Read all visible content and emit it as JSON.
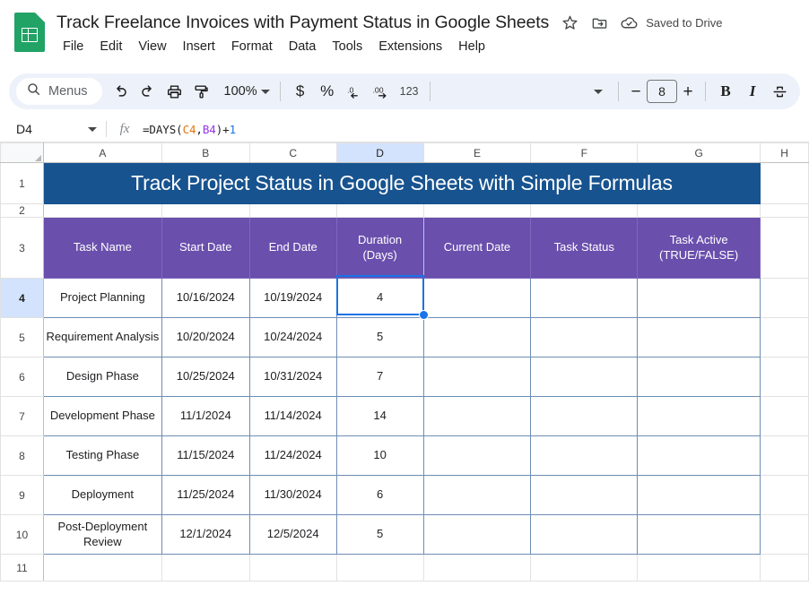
{
  "app": {
    "logo_icon": "google-sheets-logo",
    "doc_title": "Track Freelance Invoices with Payment Status in Google Sheets",
    "star_icon": "star-outline-icon",
    "move_icon": "move-to-folder-icon",
    "cloud_icon": "cloud-saved-icon",
    "save_status": "Saved to Drive"
  },
  "menubar": {
    "items": [
      {
        "label": "File"
      },
      {
        "label": "Edit"
      },
      {
        "label": "View"
      },
      {
        "label": "Insert"
      },
      {
        "label": "Format"
      },
      {
        "label": "Data"
      },
      {
        "label": "Tools"
      },
      {
        "label": "Extensions"
      },
      {
        "label": "Help"
      }
    ]
  },
  "toolbar": {
    "search_icon": "search-icon",
    "search_label": "Menus",
    "undo_icon": "undo-icon",
    "redo_icon": "redo-icon",
    "print_icon": "print-icon",
    "paint_icon": "paint-format-icon",
    "zoom_level": "100%",
    "zoom_caret_icon": "chevron-down-icon",
    "currency_label": "$",
    "percent_label": "%",
    "decimal_decrease_label": ".0",
    "decimal_increase_label": ".00",
    "more_formats_label": "123",
    "font_caret_icon": "chevron-down-icon",
    "decrease_font_label": "−",
    "font_size": "8",
    "increase_font_label": "+",
    "bold_label": "B",
    "italic_label": "I",
    "strikethrough_icon": "strikethrough-icon"
  },
  "formula_bar": {
    "name_box": "D4",
    "name_caret_icon": "chevron-down-icon",
    "fx_label": "fx",
    "formula_parts": [
      {
        "text": "=DAYS(",
        "kind": "plain"
      },
      {
        "text": "C4",
        "kind": "ref-c"
      },
      {
        "text": ",",
        "kind": "plain"
      },
      {
        "text": "B4",
        "kind": "ref-b"
      },
      {
        "text": ")+",
        "kind": "plain"
      },
      {
        "text": "1",
        "kind": "num"
      }
    ],
    "formula_text": "=DAYS(C4,B4)+1"
  },
  "grid": {
    "column_letters": [
      "A",
      "B",
      "C",
      "D",
      "E",
      "F",
      "G",
      "H"
    ],
    "selected_column": "D",
    "row_numbers": [
      "1",
      "2",
      "3",
      "4",
      "5",
      "6",
      "7",
      "8",
      "9",
      "10",
      "11"
    ],
    "selected_row": "4",
    "selected_cell": "D4",
    "banner_text": "Track Project Status in Google Sheets with Simple Formulas",
    "banner_color": "#17538F",
    "header_color": "#6A4FAD",
    "selection_color": "#1a73e8",
    "table_headers": [
      "Task Name",
      "Start Date",
      "End Date",
      "Duration (Days)",
      "Current Date",
      "Task Status",
      "Task Active (TRUE/FALSE)"
    ],
    "table_headers_lines": [
      [
        "Task Name"
      ],
      [
        "Start Date"
      ],
      [
        "End Date"
      ],
      [
        "Duration",
        "(Days)"
      ],
      [
        "Current Date"
      ],
      [
        "Task Status"
      ],
      [
        "Task Active",
        "(TRUE/FALSE)"
      ]
    ],
    "rows": [
      {
        "row": "4",
        "task_name": "Project Planning",
        "start_date": "10/16/2024",
        "end_date": "10/19/2024",
        "duration": "4",
        "current_date": "",
        "task_status": "",
        "task_active": ""
      },
      {
        "row": "5",
        "task_name": "Requirement Analysis",
        "start_date": "10/20/2024",
        "end_date": "10/24/2024",
        "duration": "5",
        "current_date": "",
        "task_status": "",
        "task_active": ""
      },
      {
        "row": "6",
        "task_name": "Design Phase",
        "start_date": "10/25/2024",
        "end_date": "10/31/2024",
        "duration": "7",
        "current_date": "",
        "task_status": "",
        "task_active": ""
      },
      {
        "row": "7",
        "task_name": "Development Phase",
        "start_date": "11/1/2024",
        "end_date": "11/14/2024",
        "duration": "14",
        "current_date": "",
        "task_status": "",
        "task_active": ""
      },
      {
        "row": "8",
        "task_name": "Testing Phase",
        "start_date": "11/15/2024",
        "end_date": "11/24/2024",
        "duration": "10",
        "current_date": "",
        "task_status": "",
        "task_active": ""
      },
      {
        "row": "9",
        "task_name": "Deployment",
        "start_date": "11/25/2024",
        "end_date": "11/30/2024",
        "duration": "6",
        "current_date": "",
        "task_status": "",
        "task_active": ""
      },
      {
        "row": "10",
        "task_name": "Post-Deployment Review",
        "start_date": "12/1/2024",
        "end_date": "12/5/2024",
        "duration": "5",
        "current_date": "",
        "task_status": "",
        "task_active": ""
      }
    ]
  }
}
